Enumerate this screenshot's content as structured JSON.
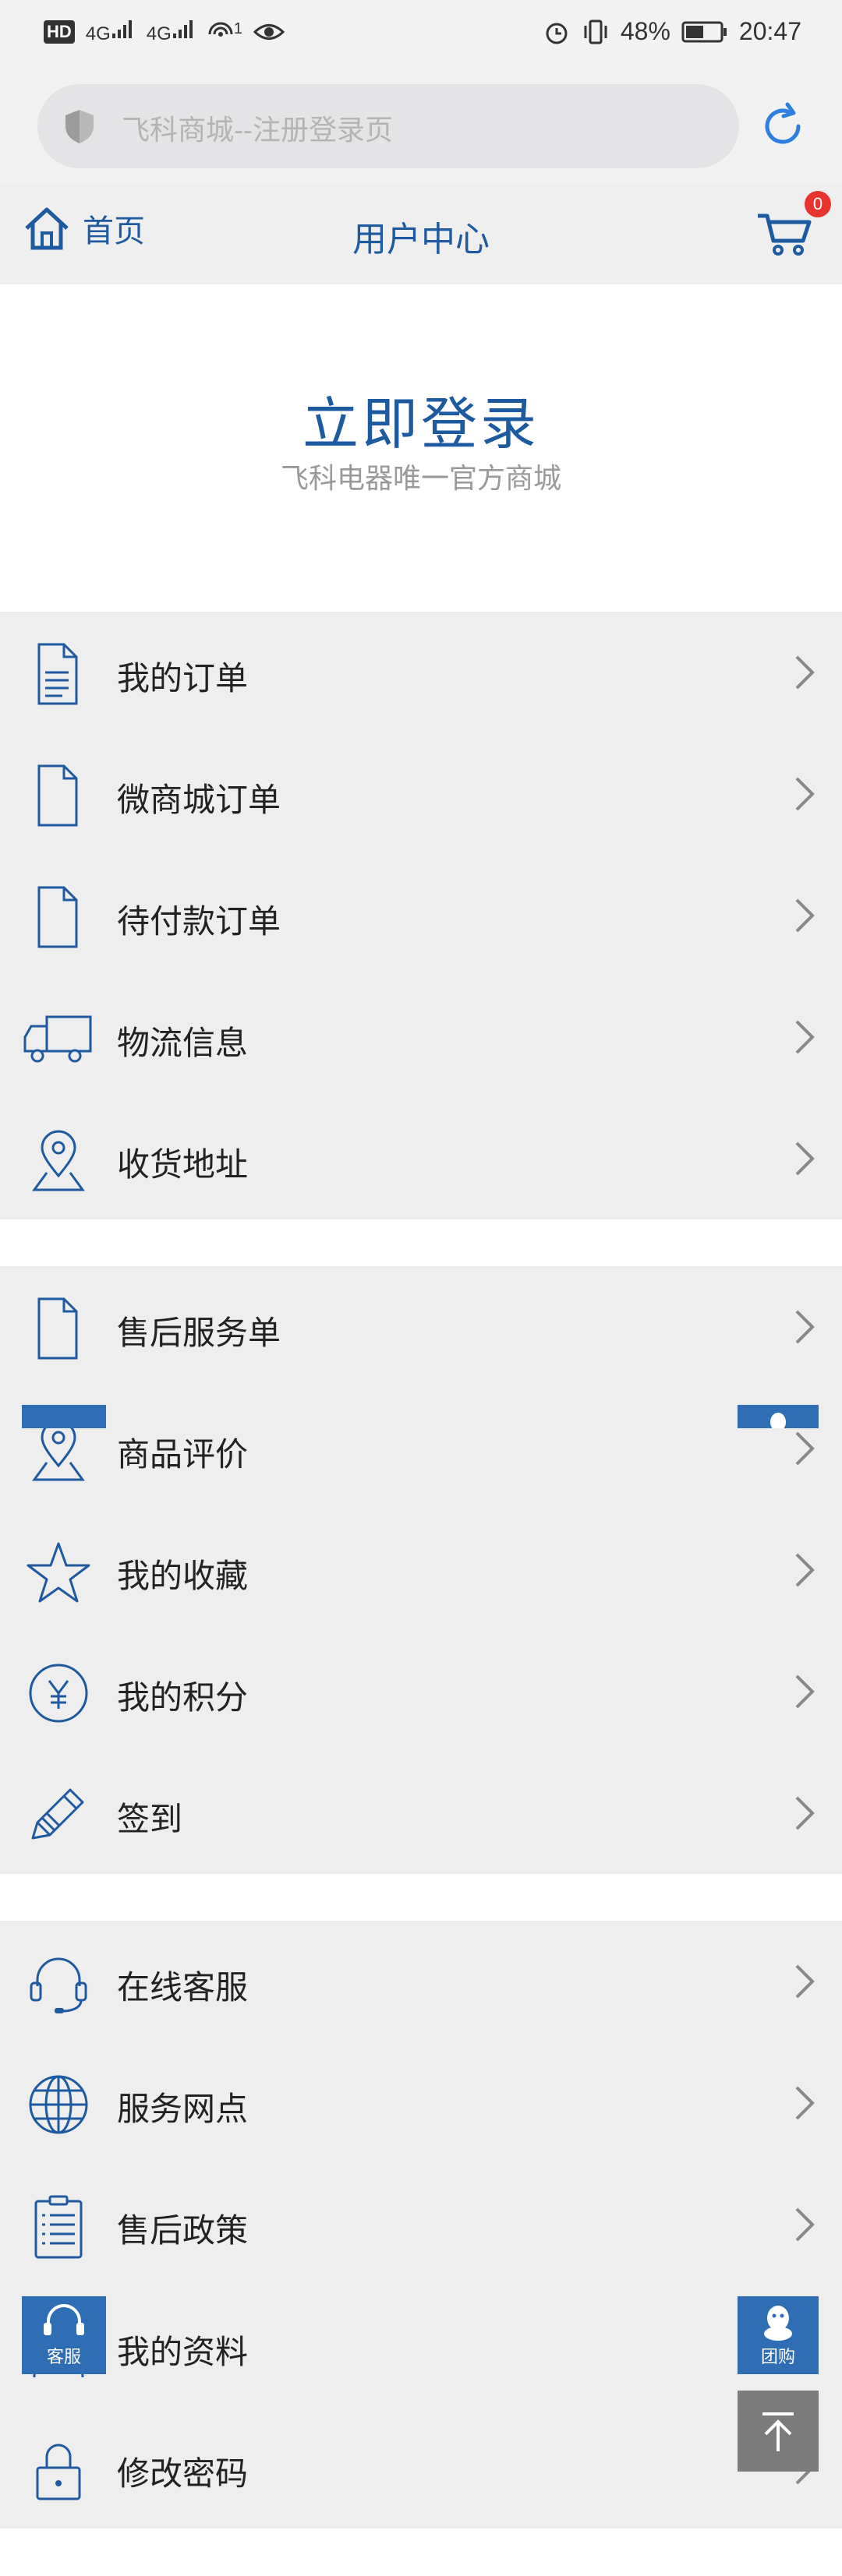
{
  "status_bar": {
    "left_badge": "HD",
    "net1": "4G",
    "net2": "4G",
    "hotspot_count": "1",
    "battery": "48%",
    "time": "20:47"
  },
  "url_bar": {
    "text": "飞科商城--注册登录页"
  },
  "nav": {
    "home_label": "首页",
    "title": "用户中心",
    "cart_count": "0"
  },
  "login": {
    "title": "立即登录",
    "subtitle": "飞科电器唯一官方商城"
  },
  "groups": [
    {
      "items": [
        {
          "label": "我的订单",
          "icon": "order-list-icon"
        },
        {
          "label": "微商城订单",
          "icon": "document-icon"
        },
        {
          "label": "待付款订单",
          "icon": "document-icon"
        },
        {
          "label": "物流信息",
          "icon": "truck-icon"
        },
        {
          "label": "收货地址",
          "icon": "location-pin-icon"
        }
      ]
    },
    {
      "items": [
        {
          "label": "售后服务单",
          "icon": "document-icon"
        },
        {
          "label": "商品评价",
          "icon": "location-pin-icon"
        },
        {
          "label": "我的收藏",
          "icon": "star-icon"
        },
        {
          "label": "我的积分",
          "icon": "yen-coin-icon"
        },
        {
          "label": "签到",
          "icon": "pencil-icon"
        }
      ]
    },
    {
      "items": [
        {
          "label": "在线客服",
          "icon": "headset-icon"
        },
        {
          "label": "服务网点",
          "icon": "globe-icon"
        },
        {
          "label": "售后政策",
          "icon": "clipboard-icon"
        },
        {
          "label": "我的资料",
          "icon": "profile-icon"
        },
        {
          "label": "修改密码",
          "icon": "lock-icon"
        }
      ]
    }
  ],
  "floating": {
    "service_label": "客服",
    "group_buy_label": "团购"
  },
  "colors": {
    "brand_blue": "#1e5aa0",
    "float_blue": "#2f6db5",
    "badge_red": "#e8342e"
  }
}
